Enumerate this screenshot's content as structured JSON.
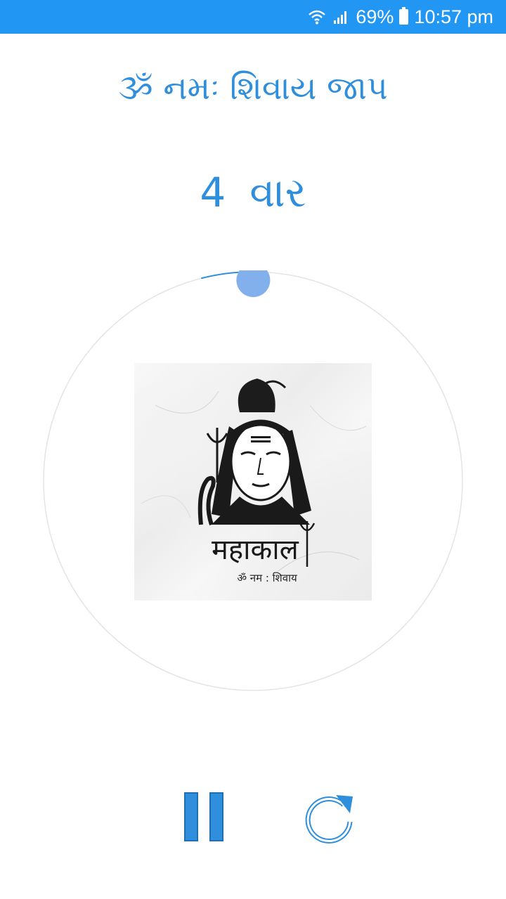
{
  "status_bar": {
    "battery": "69%",
    "time": "10:57 pm",
    "icons": [
      "wifi-icon",
      "signal-icon",
      "battery-icon"
    ],
    "color": "#2196f3"
  },
  "header": {
    "title": "ૐ નમઃ શિવાય જાપ"
  },
  "counter": {
    "count": "4",
    "unit": "વાર"
  },
  "progress": {
    "fraction": 0.04
  },
  "image": {
    "brand": "महाकाल",
    "caption": "ॐ नम : शिवाय"
  },
  "controls": {
    "pause_icon": "pause-icon",
    "reset_icon": "refresh-icon"
  },
  "colors": {
    "accent": "#2f8fdc",
    "knob": "#82b0ec",
    "ring": "#e4e4e4"
  }
}
